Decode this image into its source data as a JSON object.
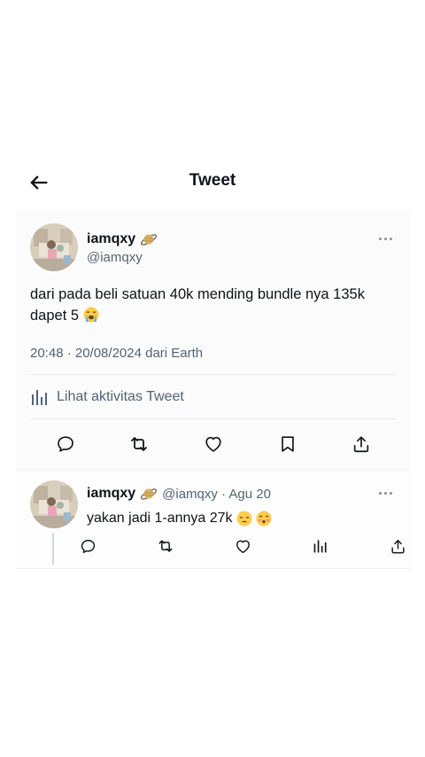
{
  "header": {
    "title": "Tweet"
  },
  "tweet": {
    "name": "iamqxy",
    "handle": "@iamqxy",
    "text_line1": "dari pada beli satuan 40k mending bundle nya 135k",
    "text_line2": "dapet 5",
    "text_emoji": "loudly-crying-face",
    "timestamp": "20:48 · 20/08/2024 dari Earth",
    "activity_label": "Lihat aktivitas Tweet",
    "badge_icon": "ringed-planet-icon"
  },
  "reply": {
    "name": "iamqxy",
    "meta": "@iamqxy · Agu 20",
    "text": "yakan jadi 1-annya 27k",
    "emojis": [
      "pensive-face",
      "kissing-face"
    ]
  },
  "colors": {
    "text": "#0f1419",
    "secondary": "#536471",
    "divider": "#e8ebed"
  }
}
